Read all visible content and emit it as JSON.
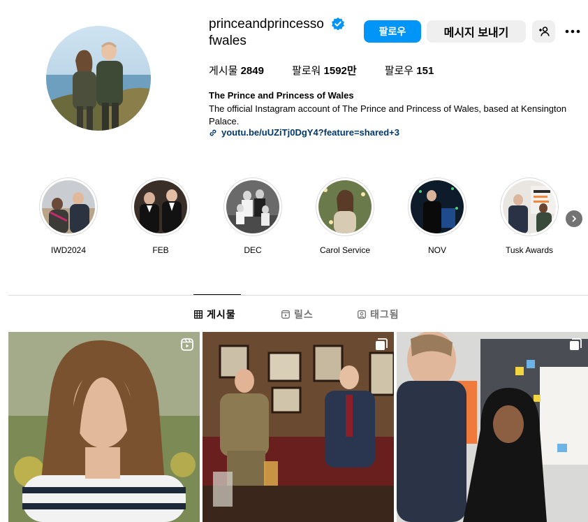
{
  "profile": {
    "username": "princeandprincessofwales",
    "follow_label": "팔로우",
    "message_label": "메시지 보내기",
    "stats": {
      "posts_label": "게시물",
      "posts_value": "2849",
      "followers_label": "팔로워",
      "followers_value": "1592만",
      "following_label": "팔로우",
      "following_value": "151"
    },
    "bio_name": "The Prince and Princess of Wales",
    "bio_text": "The official Instagram account of The Prince and Princess of Wales, based at Kensington Palace.",
    "bio_link": "youtu.be/uUZiTj0DgY4?feature=shared+3"
  },
  "highlights": [
    {
      "label": "IWD2024"
    },
    {
      "label": "FEB"
    },
    {
      "label": "DEC"
    },
    {
      "label": "Carol Service"
    },
    {
      "label": "NOV"
    },
    {
      "label": "Tusk Awards"
    }
  ],
  "tabs": {
    "posts": "게시물",
    "reels": "릴스",
    "tagged": "태그됨"
  },
  "colors": {
    "accent": "#0095f6",
    "button_gray": "#efefef",
    "link": "#00376b"
  },
  "icons": {
    "verified": "verified-badge-icon",
    "add_user": "add-user-icon",
    "more": "more-options-icon",
    "link": "link-icon",
    "next": "chevron-right-icon",
    "grid": "grid-icon",
    "reels": "reels-icon",
    "tagged": "tagged-icon",
    "reel_badge": "reel-icon",
    "carousel_badge": "carousel-icon"
  }
}
